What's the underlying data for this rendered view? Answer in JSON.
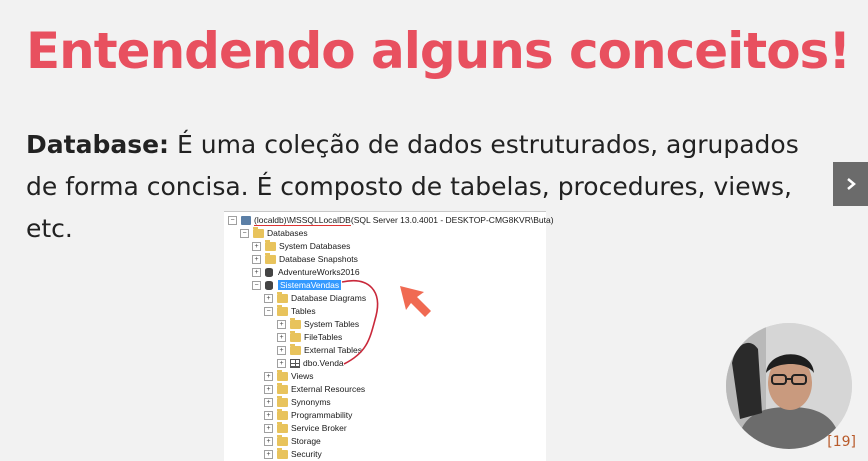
{
  "slide": {
    "title": "Entendendo alguns conceitos!",
    "term": "Database:",
    "definition": " É uma coleção de dados estruturados, agrupados de forma concisa. É composto de tabelas, procedures, views, etc.",
    "page_number": "[19]",
    "title_color": "#e8505f"
  },
  "tree": {
    "server": "(localdb)\\MSSQLLocalDB",
    "server_info": " (SQL Server 13.0.4001 - DESKTOP-CMG8KVR\\Buta)",
    "databases": "Databases",
    "system_databases": "System Databases",
    "database_snapshots": "Database Snapshots",
    "adventureworks": "AdventureWorks2016",
    "sistemavendas": "SistemaVendas",
    "database_diagrams": "Database Diagrams",
    "tables": "Tables",
    "system_tables": "System Tables",
    "filetables": "FileTables",
    "external_tables": "External Tables",
    "dbo_venda": "dbo.Venda",
    "views": "Views",
    "external_resources": "External Resources",
    "synonyms": "Synonyms",
    "programmability": "Programmability",
    "service_broker": "Service Broker",
    "storage": "Storage",
    "security": "Security"
  },
  "icons": {
    "next": "chevron-right-icon",
    "folder": "folder-icon",
    "database": "database-icon",
    "server": "server-icon",
    "table": "table-icon"
  }
}
